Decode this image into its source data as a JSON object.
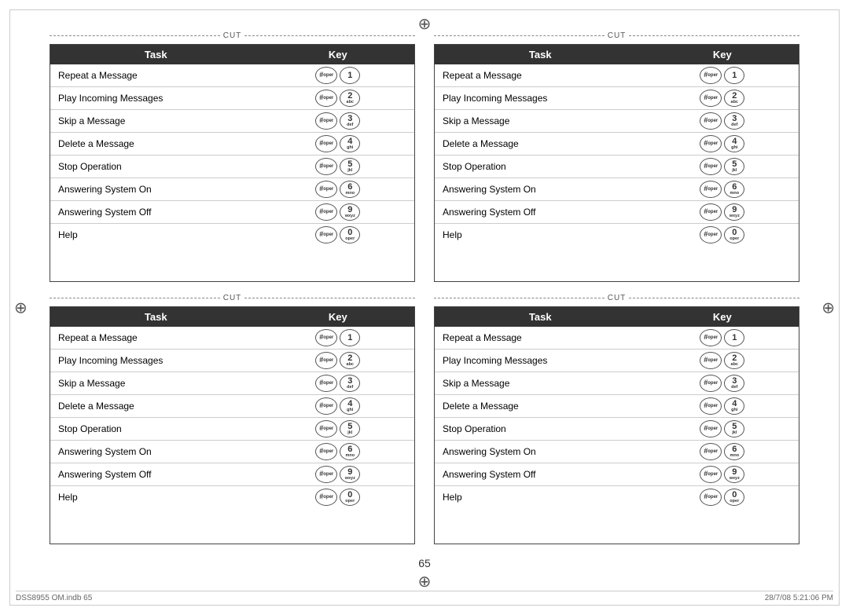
{
  "page": {
    "number": "65",
    "footer_left": "DSS8955 OM.indb   65",
    "footer_right": "28/7/08   5:21:06 PM"
  },
  "cut_label": "CUT",
  "tables": [
    {
      "id": "top-left",
      "headers": [
        "Task",
        "Key"
      ],
      "rows": [
        {
          "task": "Repeat a Message",
          "key_hash": "#oper",
          "key_num": "1",
          "key_sub": ""
        },
        {
          "task": "Play Incoming Messages",
          "key_hash": "#oper",
          "key_num": "2",
          "key_sub": "abc"
        },
        {
          "task": "Skip a Message",
          "key_hash": "#oper",
          "key_num": "3",
          "key_sub": "def"
        },
        {
          "task": "Delete a Message",
          "key_hash": "#oper",
          "key_num": "4",
          "key_sub": "ghi"
        },
        {
          "task": "Stop Operation",
          "key_hash": "#oper",
          "key_num": "5",
          "key_sub": "jkl"
        },
        {
          "task": "Answering System On",
          "key_hash": "#oper",
          "key_num": "6",
          "key_sub": "mno"
        },
        {
          "task": "Answering System Off",
          "key_hash": "#oper",
          "key_num": "9",
          "key_sub": "wxyz"
        },
        {
          "task": "Help",
          "key_hash": "#oper",
          "key_num": "0",
          "key_sub": "oper"
        }
      ]
    },
    {
      "id": "top-right",
      "headers": [
        "Task",
        "Key"
      ],
      "rows": [
        {
          "task": "Repeat a Message",
          "key_hash": "#oper",
          "key_num": "1",
          "key_sub": ""
        },
        {
          "task": "Play Incoming Messages",
          "key_hash": "#oper",
          "key_num": "2",
          "key_sub": "abc"
        },
        {
          "task": "Skip a Message",
          "key_hash": "#oper",
          "key_num": "3",
          "key_sub": "def"
        },
        {
          "task": "Delete a Message",
          "key_hash": "#oper",
          "key_num": "4",
          "key_sub": "ghi"
        },
        {
          "task": "Stop Operation",
          "key_hash": "#oper",
          "key_num": "5",
          "key_sub": "jkl"
        },
        {
          "task": "Answering System On",
          "key_hash": "#oper",
          "key_num": "6",
          "key_sub": "mno"
        },
        {
          "task": "Answering System Off",
          "key_hash": "#oper",
          "key_num": "9",
          "key_sub": "wxyz"
        },
        {
          "task": "Help",
          "key_hash": "#oper",
          "key_num": "0",
          "key_sub": "oper"
        }
      ]
    },
    {
      "id": "bottom-left",
      "headers": [
        "Task",
        "Key"
      ],
      "rows": [
        {
          "task": "Repeat a Message",
          "key_hash": "#oper",
          "key_num": "1",
          "key_sub": ""
        },
        {
          "task": "Play Incoming Messages",
          "key_hash": "#oper",
          "key_num": "2",
          "key_sub": "abc"
        },
        {
          "task": "Skip a Message",
          "key_hash": "#oper",
          "key_num": "3",
          "key_sub": "def"
        },
        {
          "task": "Delete a Message",
          "key_hash": "#oper",
          "key_num": "4",
          "key_sub": "ghi"
        },
        {
          "task": "Stop Operation",
          "key_hash": "#oper",
          "key_num": "5",
          "key_sub": "jkl"
        },
        {
          "task": "Answering System On",
          "key_hash": "#oper",
          "key_num": "6",
          "key_sub": "mno"
        },
        {
          "task": "Answering System Off",
          "key_hash": "#oper",
          "key_num": "9",
          "key_sub": "wxyz"
        },
        {
          "task": "Help",
          "key_hash": "#oper",
          "key_num": "0",
          "key_sub": "oper"
        }
      ]
    },
    {
      "id": "bottom-right",
      "headers": [
        "Task",
        "Key"
      ],
      "rows": [
        {
          "task": "Repeat a Message",
          "key_hash": "#oper",
          "key_num": "1",
          "key_sub": ""
        },
        {
          "task": "Play Incoming Messages",
          "key_hash": "#oper",
          "key_num": "2",
          "key_sub": "abc"
        },
        {
          "task": "Skip a Message",
          "key_hash": "#oper",
          "key_num": "3",
          "key_sub": "def"
        },
        {
          "task": "Delete a Message",
          "key_hash": "#oper",
          "key_num": "4",
          "key_sub": "ghi"
        },
        {
          "task": "Stop Operation",
          "key_hash": "#oper",
          "key_num": "5",
          "key_sub": "jkl"
        },
        {
          "task": "Answering System On",
          "key_hash": "#oper",
          "key_num": "6",
          "key_sub": "mno"
        },
        {
          "task": "Answering System Off",
          "key_hash": "#oper",
          "key_num": "9",
          "key_sub": "wxyz"
        },
        {
          "task": "Help",
          "key_hash": "#oper",
          "key_num": "0",
          "key_sub": "oper"
        }
      ]
    }
  ]
}
